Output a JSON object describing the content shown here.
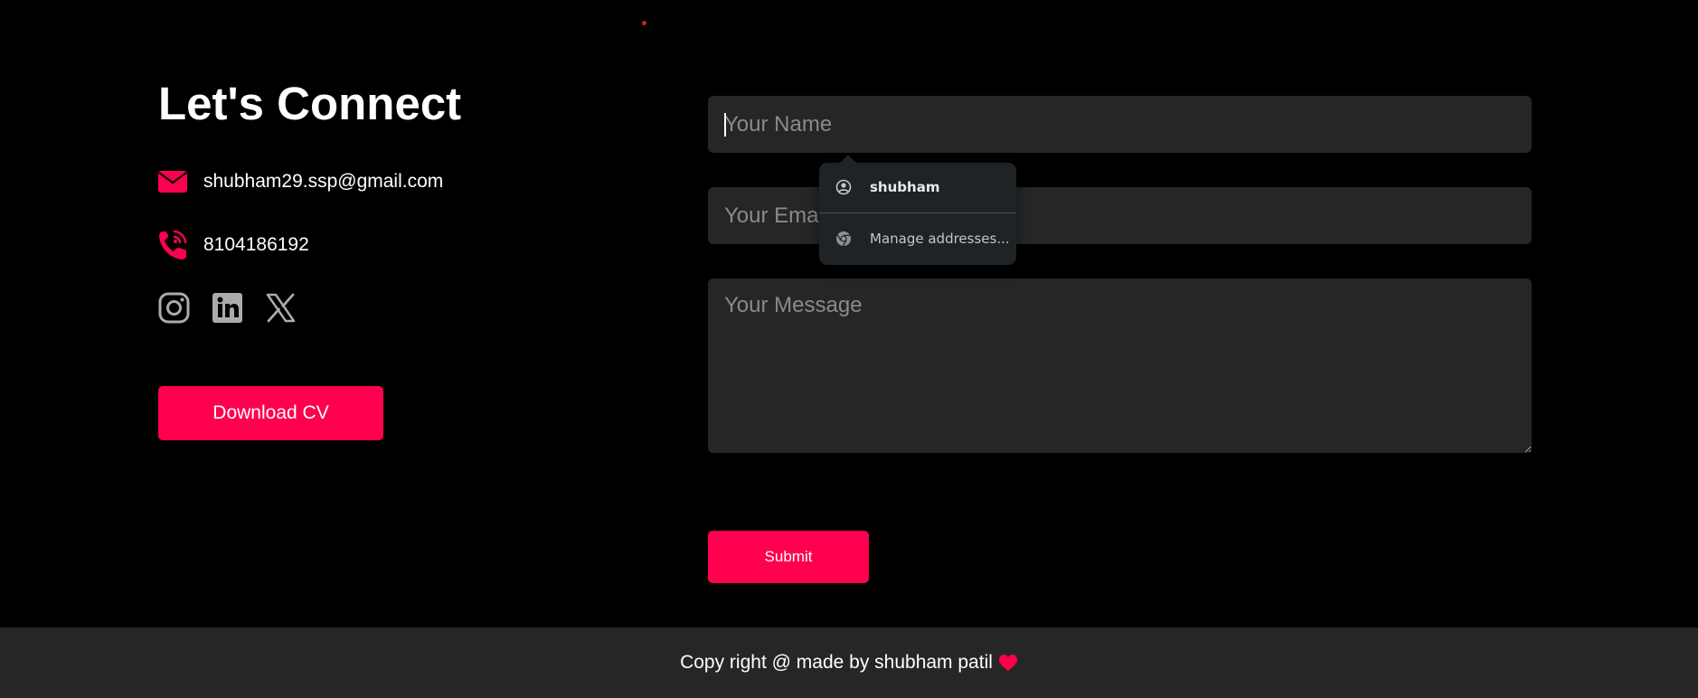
{
  "contact": {
    "title": "Let's Connect",
    "email": "shubham29.ssp@gmail.com",
    "phone": "8104186192",
    "socials": [
      "instagram-icon",
      "linkedin-icon",
      "x-twitter-icon"
    ],
    "download_label": "Download CV"
  },
  "form": {
    "name_placeholder": "Your Name",
    "email_placeholder": "Your Email",
    "message_placeholder": "Your Message",
    "submit_label": "Submit"
  },
  "autofill": {
    "profile_name": "shubham",
    "manage_label": "Manage addresses..."
  },
  "footer": {
    "text": "Copy right @ made by shubham patil"
  },
  "colors": {
    "accent": "#ff004f",
    "background": "#000000",
    "field_bg": "#262626",
    "footer_bg": "#262626",
    "social_icon": "#ababab",
    "autofill_bg": "#1f2326"
  },
  "icons": {
    "email": "envelope-icon",
    "phone": "phone-ringing-icon",
    "heart": "heart-icon",
    "profile": "account-circle-icon",
    "manage": "chrome-icon"
  }
}
